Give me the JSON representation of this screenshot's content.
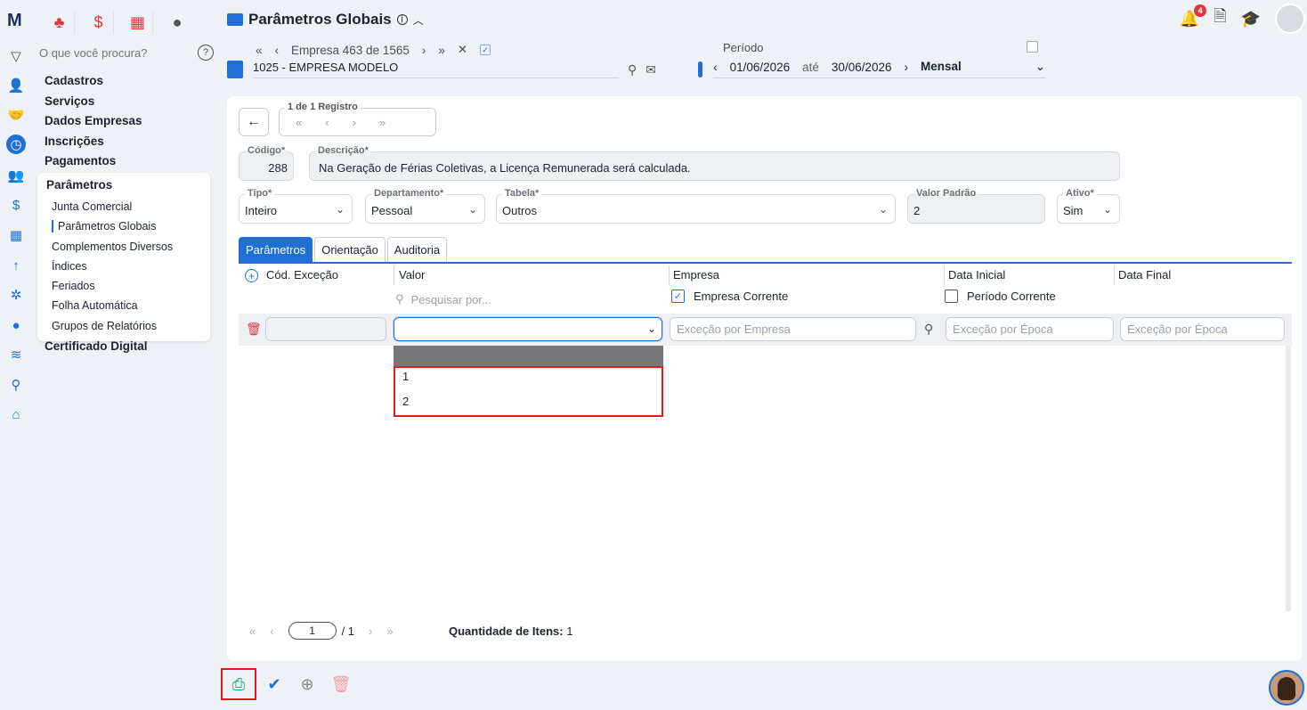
{
  "app": {
    "logo": "M"
  },
  "topbar_icons": [
    "people-icon",
    "dollar-icon",
    "calculator-icon",
    "moneybag-icon"
  ],
  "search": {
    "placeholder": "O que você procura?",
    "help": "?"
  },
  "menu": {
    "items": [
      "Cadastros",
      "Serviços",
      "Dados Empresas",
      "Inscrições",
      "Pagamentos"
    ],
    "submenu": {
      "title": "Parâmetros",
      "items": [
        "Junta Comercial",
        "Parâmetros Globais",
        "Complementos Diversos",
        "Índices",
        "Feriados",
        "Folha Automática",
        "Grupos de Relatórios"
      ],
      "selected_index": 1
    },
    "after": "Certificado Digital"
  },
  "header": {
    "title": "Parâmetros Globais",
    "notifications_count": "4"
  },
  "empresa": {
    "nav_text": "Empresa 463 de 1565",
    "name": "1025 - EMPRESA MODELO"
  },
  "periodo": {
    "label": "Período",
    "start": "01/06/2026",
    "ate": "até",
    "end": "30/06/2026",
    "freq": "Mensal"
  },
  "registro": {
    "label": "1 de 1 Registro"
  },
  "form": {
    "codigo": {
      "label": "Código*",
      "value": "288"
    },
    "descricao": {
      "label": "Descrição*",
      "value": "Na Geração de Férias Coletivas, a Licença Remunerada será calculada."
    },
    "tipo": {
      "label": "Tipo*",
      "value": "Inteiro"
    },
    "departamento": {
      "label": "Departamento*",
      "value": "Pessoal"
    },
    "tabela": {
      "label": "Tabela*",
      "value": "Outros"
    },
    "valor_padrao": {
      "label": "Valor Padrão",
      "value": "2"
    },
    "ativo": {
      "label": "Ativo*",
      "value": "Sim"
    }
  },
  "tabs": [
    "Parâmetros",
    "Orientação",
    "Auditoria"
  ],
  "grid": {
    "headers": [
      "Cód. Exceção",
      "Valor",
      "Empresa",
      "Data Inicial",
      "Data Final"
    ],
    "search_placeholder": "Pesquisar por...",
    "empresa_corrente": "Empresa Corrente",
    "periodo_corrente": "Período Corrente",
    "filter_empresa_placeholder": "Exceção por Empresa",
    "filter_epoca1_placeholder": "Exceção por Época",
    "filter_epoca2_placeholder": "Exceção por Época",
    "dropdown_options": [
      "1",
      "2"
    ]
  },
  "pager": {
    "page": "1",
    "total": "/ 1",
    "qty_label": "Quantidade de Itens:",
    "qty_value": "1"
  },
  "colors": {
    "accent": "#1f6fd6",
    "danger": "#e01b1b",
    "save": "#1fa37a"
  }
}
